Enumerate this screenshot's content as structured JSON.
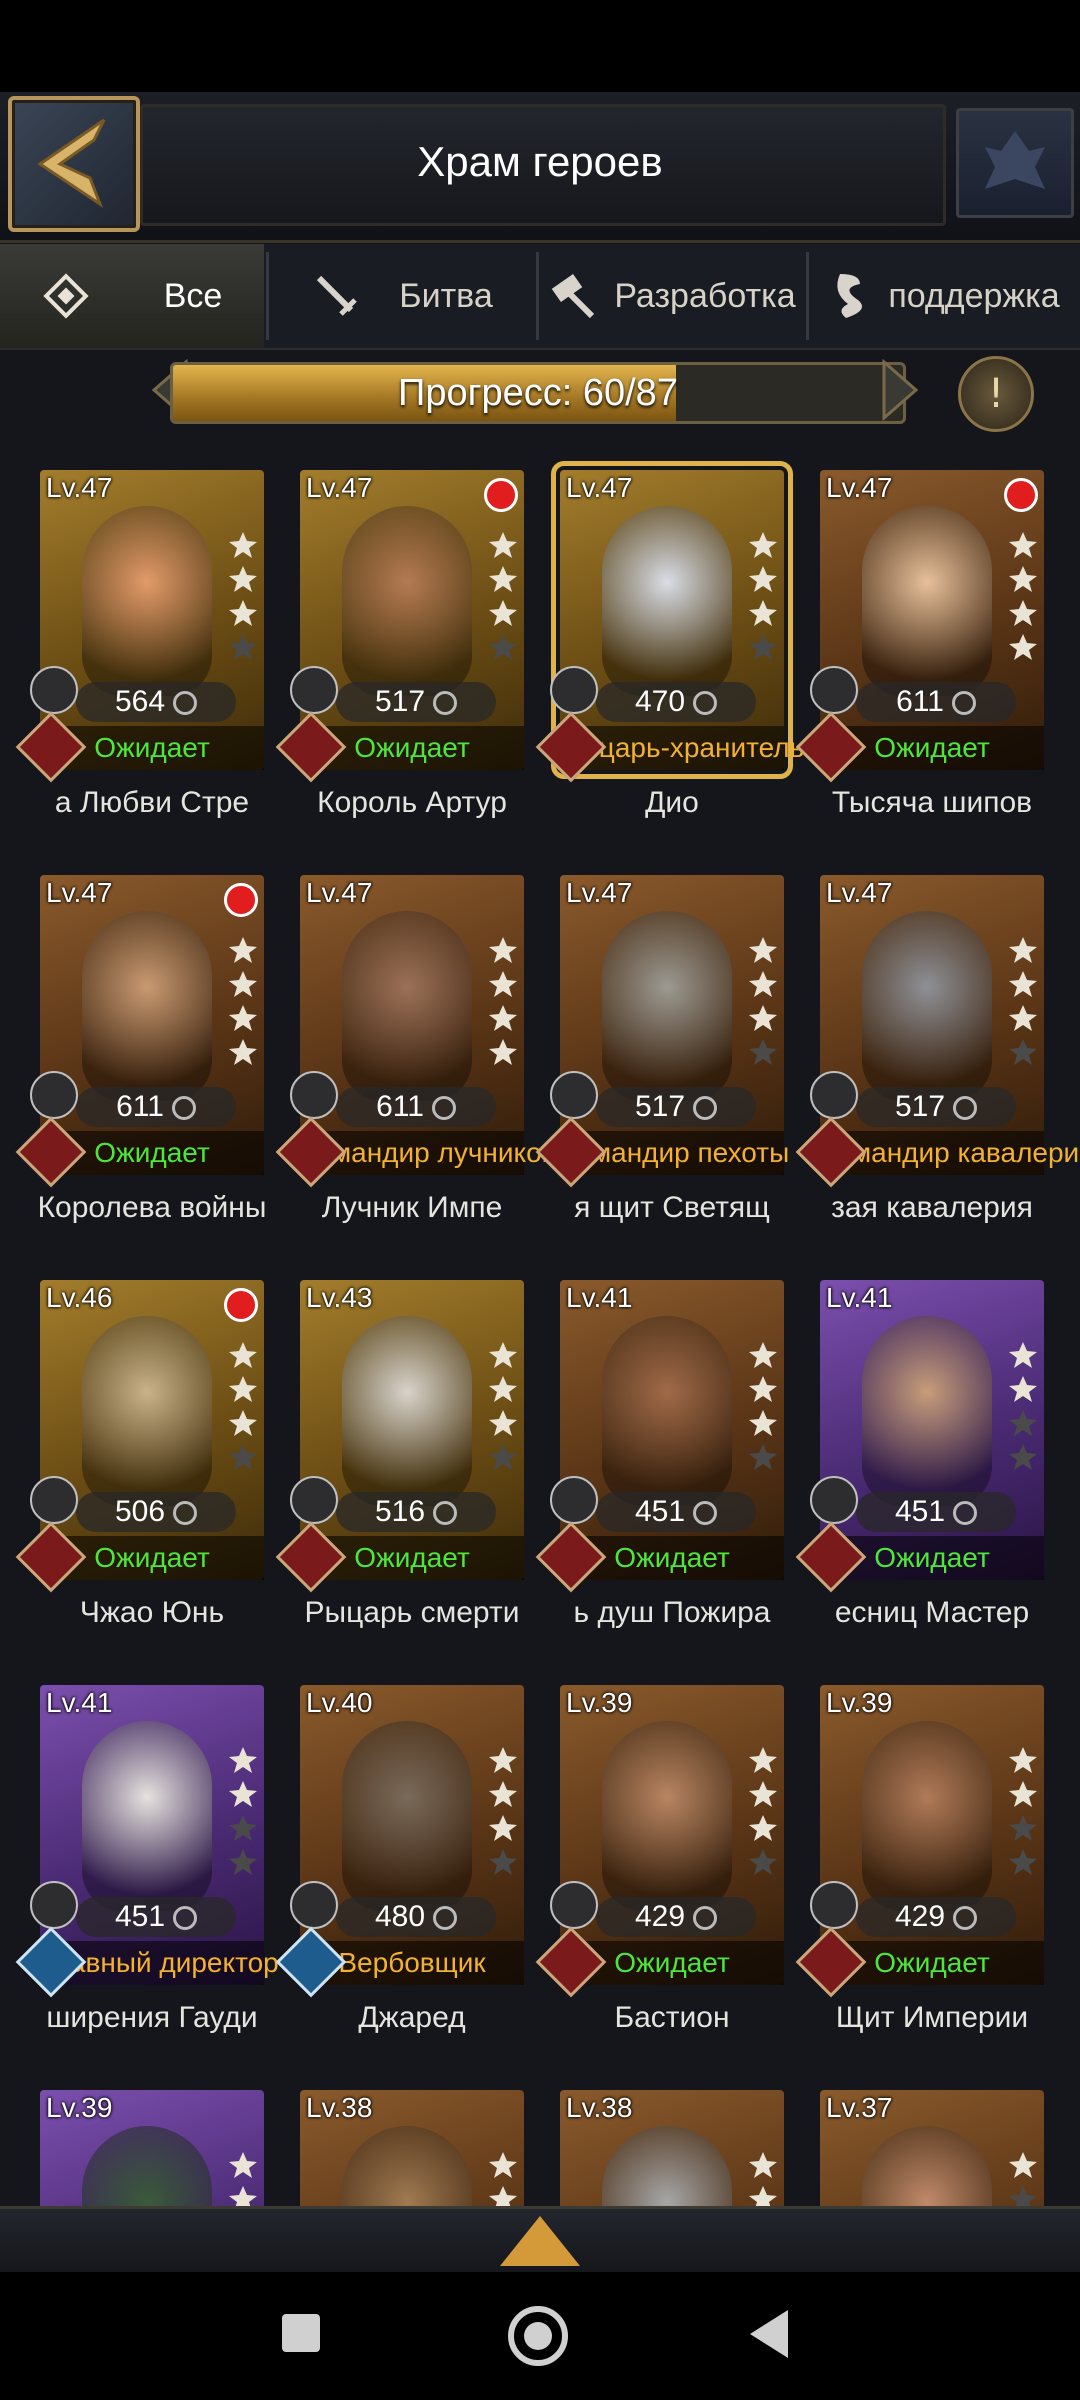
{
  "header": {
    "title": "Храм героев"
  },
  "tabs": [
    {
      "label": "Все",
      "icon": "diamond-icon",
      "active": true
    },
    {
      "label": "Битва",
      "icon": "sword-icon",
      "active": false
    },
    {
      "label": "Разработка",
      "icon": "hammer-icon",
      "active": false
    },
    {
      "label": "поддержка",
      "icon": "scroll-icon",
      "active": false
    }
  ],
  "progress": {
    "text": "Прогресс: 60/87",
    "current": 60,
    "total": 87
  },
  "help_label": "!",
  "heroes": [
    {
      "level": "Lv.47",
      "power": "564",
      "status": "Ожидает",
      "status_type": "wait",
      "name": "а Любви      Стре",
      "rarity": "gold",
      "stars": 3,
      "red_dot": false,
      "class": "red",
      "skin": "#e39a6a"
    },
    {
      "level": "Lv.47",
      "power": "517",
      "status": "Ожидает",
      "status_type": "wait",
      "name": "Король Артур",
      "rarity": "gold",
      "stars": 3,
      "red_dot": true,
      "class": "red",
      "skin": "#b57a52"
    },
    {
      "level": "Lv.47",
      "power": "470",
      "status": "Рыцарь-хранитель",
      "status_type": "role",
      "name": "Дио",
      "rarity": "gold",
      "stars": 3,
      "red_dot": false,
      "class": "red",
      "skin": "#d9dde6",
      "selected": true
    },
    {
      "level": "Lv.47",
      "power": "611",
      "status": "Ожидает",
      "status_type": "wait",
      "name": "Тысяча шипов",
      "rarity": "bronze",
      "stars": 4,
      "red_dot": true,
      "class": "red",
      "skin": "#e7c09a"
    },
    {
      "level": "Lv.47",
      "power": "611",
      "status": "Ожидает",
      "status_type": "wait",
      "name": "Королева войны",
      "rarity": "bronze",
      "stars": 4,
      "red_dot": true,
      "class": "red",
      "skin": "#c99a72"
    },
    {
      "level": "Lv.47",
      "power": "611",
      "status": "Командир лучников",
      "status_type": "role",
      "name": "Лучник      Импе",
      "rarity": "bronze",
      "stars": 4,
      "red_dot": false,
      "class": "red",
      "skin": "#9c7158"
    },
    {
      "level": "Lv.47",
      "power": "517",
      "status": "Командир пехоты",
      "status_type": "role",
      "name": "я щит      Светящ",
      "rarity": "bronze",
      "stars": 3,
      "red_dot": false,
      "class": "red",
      "skin": "#9c9a92"
    },
    {
      "level": "Lv.47",
      "power": "517",
      "status": "Командир кавалерии",
      "status_type": "role",
      "name": "зая кавалерия",
      "rarity": "bronze",
      "stars": 3,
      "red_dot": false,
      "class": "red",
      "skin": "#8e9096"
    },
    {
      "level": "Lv.46",
      "power": "506",
      "status": "Ожидает",
      "status_type": "wait",
      "name": "Чжао Юнь",
      "rarity": "gold",
      "stars": 3,
      "red_dot": true,
      "class": "red",
      "skin": "#c9b28a"
    },
    {
      "level": "Lv.43",
      "power": "516",
      "status": "Ожидает",
      "status_type": "wait",
      "name": "Рыцарь смерти",
      "rarity": "gold",
      "stars": 3,
      "red_dot": false,
      "class": "red",
      "skin": "#d8d4cc"
    },
    {
      "level": "Lv.41",
      "power": "451",
      "status": "Ожидает",
      "status_type": "wait",
      "name": "ь душ      Пожира",
      "rarity": "bronze",
      "stars": 3,
      "red_dot": false,
      "class": "red",
      "skin": "#a06a48"
    },
    {
      "level": "Lv.41",
      "power": "451",
      "status": "Ожидает",
      "status_type": "wait",
      "name": "есниц      Мастер",
      "rarity": "purple",
      "stars": 2,
      "red_dot": false,
      "class": "red",
      "skin": "#c79d7a"
    },
    {
      "level": "Lv.41",
      "power": "451",
      "status": "Главный директор по развитию",
      "status_type": "role",
      "name": "ширения Гауди",
      "rarity": "purple",
      "stars": 2,
      "red_dot": false,
      "class": "blue",
      "skin": "#e6e2de"
    },
    {
      "level": "Lv.40",
      "power": "480",
      "status": "Вербовщик",
      "status_type": "role",
      "name": "Джаред",
      "rarity": "bronze",
      "stars": 3,
      "red_dot": false,
      "class": "blue",
      "skin": "#7a6a5a"
    },
    {
      "level": "Lv.39",
      "power": "429",
      "status": "Ожидает",
      "status_type": "wait",
      "name": "Бастион",
      "rarity": "bronze",
      "stars": 3,
      "red_dot": false,
      "class": "red",
      "skin": "#b88562"
    },
    {
      "level": "Lv.39",
      "power": "429",
      "status": "Ожидает",
      "status_type": "wait",
      "name": "Щит Империи",
      "rarity": "bronze",
      "stars": 2,
      "red_dot": false,
      "class": "red",
      "skin": "#b07a58"
    },
    {
      "level": "Lv.39",
      "power": "",
      "status": "",
      "status_type": "none",
      "name": "",
      "rarity": "purple",
      "stars": 2,
      "red_dot": false,
      "class": "none",
      "skin": "#3a5a3a"
    },
    {
      "level": "Lv.38",
      "power": "",
      "status": "",
      "status_type": "none",
      "name": "",
      "rarity": "bronze",
      "stars": 2,
      "red_dot": false,
      "class": "none",
      "skin": "#a07a52"
    },
    {
      "level": "Lv.38",
      "power": "",
      "status": "",
      "status_type": "none",
      "name": "",
      "rarity": "bronze",
      "stars": 2,
      "red_dot": false,
      "class": "none",
      "skin": "#a7a7a7"
    },
    {
      "level": "Lv.37",
      "power": "",
      "status": "",
      "status_type": "none",
      "name": "",
      "rarity": "bronze",
      "stars": 1,
      "red_dot": false,
      "class": "none",
      "skin": "#c08a6a"
    }
  ],
  "colors": {
    "accent_gold": "#e0b24a",
    "status_wait": "#4ee63a",
    "status_role": "#f3b131",
    "red_dot": "#e11d1d"
  }
}
